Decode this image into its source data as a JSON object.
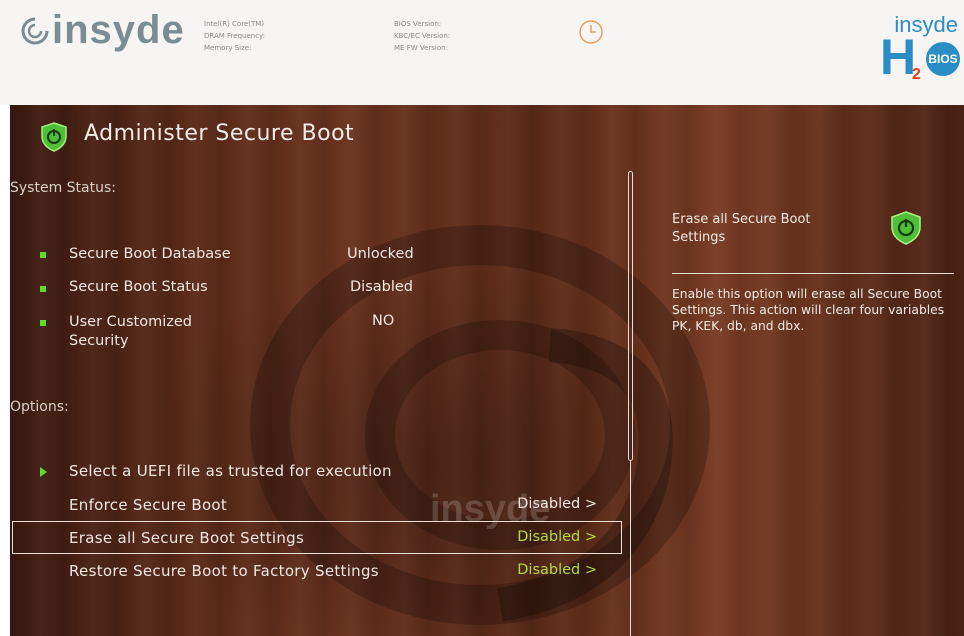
{
  "header": {
    "logo_text": "insyde",
    "sysinfo_left": [
      "Intel(R) Core(TM)",
      "DRAM Frequency:",
      "Memory Size:"
    ],
    "sysinfo_right": [
      "BIOS Version:",
      "KBC/EC Version:",
      "ME FW Version:"
    ],
    "brand_small": "insyde",
    "brand_h": "H",
    "brand_2": "2",
    "brand_bios": "BIOS",
    "icons": [
      "insyde-logo-icon",
      "clock-icon",
      "h2o-bios-logo-icon"
    ]
  },
  "page": {
    "title": "Administer Secure Boot",
    "title_icon": "shield-power-icon"
  },
  "system_status": {
    "label": "System Status:",
    "rows": [
      {
        "label": "Secure Boot Database",
        "value": "Unlocked"
      },
      {
        "label": "Secure Boot Status",
        "value": "Disabled"
      },
      {
        "label_line1": "User Customized",
        "label_line2": "Security",
        "value": "NO"
      }
    ]
  },
  "options": {
    "label": "Options:",
    "items": [
      {
        "label": "Select a UEFI file as trusted for execution",
        "value": ""
      },
      {
        "label": "Enforce Secure Boot",
        "value": "Disabled >"
      },
      {
        "label": "Erase all Secure Boot Settings",
        "value": "Disabled >"
      },
      {
        "label": "Restore Secure Boot to Factory Settings",
        "value": "Disabled >"
      }
    ],
    "selected_index": 2
  },
  "help": {
    "title": "Erase all Secure Boot Settings",
    "body": "Enable this option will erase all Secure Boot Settings. This action will clear four variables PK, KEK, db, and dbx."
  },
  "colors": {
    "accent_green": "#5ddc2a",
    "value_green": "#b4dc3a",
    "brand_blue": "#2a8dc6"
  }
}
